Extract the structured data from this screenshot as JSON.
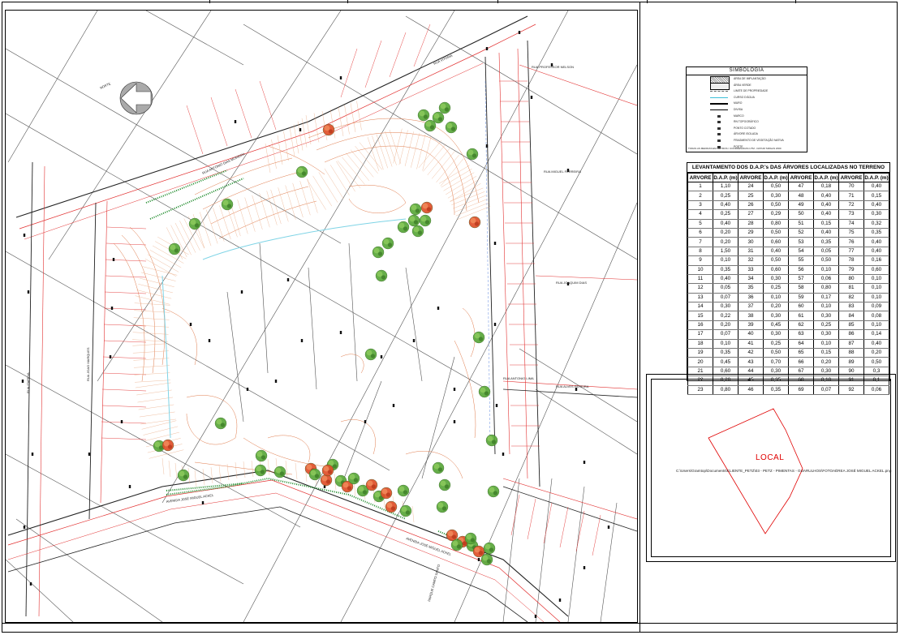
{
  "map": {
    "north_label": "NORTE",
    "streets": {
      "top_left": "RUA ANTONIO DIAS MOREIRA",
      "top_small": "RUA VITORIA",
      "top_right": "RUA PROFESSOR NELSON",
      "left_a": "RUA ITAPEVA",
      "left_b": "RUA JOAO MARQUES",
      "right_a": "RUA MIGUEL FERREIRA",
      "right_b": "RUA JOAQUIM DIAS",
      "right_c": "RUA ANTONIO LIMA",
      "right_d": "RUA ALVES PEREIRA",
      "bottom_a": "AVENIDA JOSÉ MIGUEL ACKEL",
      "bottom_b": "AVENIDA JOSÉ MIGUEL ACKEL",
      "bottom_c": "PARQUE CAMPO SANTO"
    }
  },
  "legend": {
    "title": "SIMBOLOGIA",
    "items": [
      "ÁREA DE IMPLANTAÇÃO",
      "ÁREA VERDE",
      "LIMITE DE PROPRIEDADE",
      "CURSO D'ÁGUA",
      "MURO",
      "DIVISA",
      "MARCO",
      "RN TOPOGRÁFICO",
      "PONTO COTADO",
      "ÁRVORE ISOLADA",
      "FRAGMENTO DE VEGETAÇÃO NATIVA",
      "POSTE"
    ],
    "footnote": "TODAS AS MEDIDAS EM METROS / COORDENADAS UTM - DATUM SIRGAS 2000"
  },
  "table": {
    "title": "LEVANTAMENTO DOS D.A.P.'s DAS ÁRVORES LOCALIZADAS NO TERRENO",
    "header": [
      "ARVORE",
      "D.A.P. (m)",
      "ARVORE",
      "D.A.P. (m)",
      "ARVORE",
      "D.A.P. (m)",
      "ARVORE",
      "D.A.P. (m)"
    ],
    "rows": [
      [
        "1",
        "1,10",
        "24",
        "0,50",
        "47",
        "0,18",
        "70",
        "0,40"
      ],
      [
        "2",
        "0,25",
        "25",
        "0,30",
        "48",
        "0,40",
        "71",
        "0,15"
      ],
      [
        "3",
        "0,40",
        "26",
        "0,50",
        "49",
        "0,40",
        "72",
        "0,40"
      ],
      [
        "4",
        "0,25",
        "27",
        "0,29",
        "50",
        "0,40",
        "73",
        "0,30"
      ],
      [
        "5",
        "0,40",
        "28",
        "0,80",
        "51",
        "0,15",
        "74",
        "0,32"
      ],
      [
        "6",
        "0,20",
        "29",
        "0,50",
        "52",
        "0,40",
        "75",
        "0,35"
      ],
      [
        "7",
        "0,20",
        "30",
        "0,60",
        "53",
        "0,35",
        "76",
        "0,40"
      ],
      [
        "8",
        "1,50",
        "31",
        "0,40",
        "54",
        "0,05",
        "77",
        "0,40"
      ],
      [
        "9",
        "0,10",
        "32",
        "0,50",
        "55",
        "0,50",
        "78",
        "0,16"
      ],
      [
        "10",
        "0,35",
        "33",
        "0,60",
        "56",
        "0,10",
        "79",
        "0,60"
      ],
      [
        "11",
        "0,40",
        "34",
        "0,30",
        "57",
        "0,06",
        "80",
        "0,10"
      ],
      [
        "12",
        "0,05",
        "35",
        "0,25",
        "58",
        "0,80",
        "81",
        "0,10"
      ],
      [
        "13",
        "0,07",
        "36",
        "0,10",
        "59",
        "0,17",
        "82",
        "0,10"
      ],
      [
        "14",
        "0,30",
        "37",
        "0,20",
        "60",
        "0,10",
        "83",
        "0,09"
      ],
      [
        "15",
        "0,22",
        "38",
        "0,30",
        "61",
        "0,30",
        "84",
        "0,08"
      ],
      [
        "16",
        "0,20",
        "39",
        "0,45",
        "62",
        "0,25",
        "85",
        "0,10"
      ],
      [
        "17",
        "0,07",
        "40",
        "0,30",
        "63",
        "0,30",
        "86",
        "0,14"
      ],
      [
        "18",
        "0,10",
        "41",
        "0,25",
        "64",
        "0,10",
        "87",
        "0,40"
      ],
      [
        "19",
        "0,35",
        "42",
        "0,50",
        "65",
        "0,15",
        "88",
        "0,20"
      ],
      [
        "20",
        "0,45",
        "43",
        "0,70",
        "66",
        "0,20",
        "89",
        "0,50"
      ],
      [
        "21",
        "0,60",
        "44",
        "0,30",
        "67",
        "0,30",
        "90",
        "0,3"
      ],
      [
        "22",
        "0,20",
        "45",
        "0,35",
        "68",
        "0,10",
        "91",
        "0,1"
      ],
      [
        "23",
        "0,80",
        "46",
        "0,35",
        "69",
        "0,07",
        "92",
        "0,06"
      ]
    ]
  },
  "location": {
    "label": "LOCAL",
    "file_path": "C:\\Users\\Gramtop\\Documents\\CLIENTE_PETZ\\03 - PETZ - PIMENTAS - GUARULHOS\\FOTOAÉREA JOSÉ MIGUEL ACKEL.png"
  },
  "colors": {
    "contour": "#e07a4a",
    "street_line": "#e23030",
    "tree_green": "#5aa83a",
    "tree_red": "#e0502a",
    "water": "#7fd4e6",
    "location_red": "#e00000"
  }
}
